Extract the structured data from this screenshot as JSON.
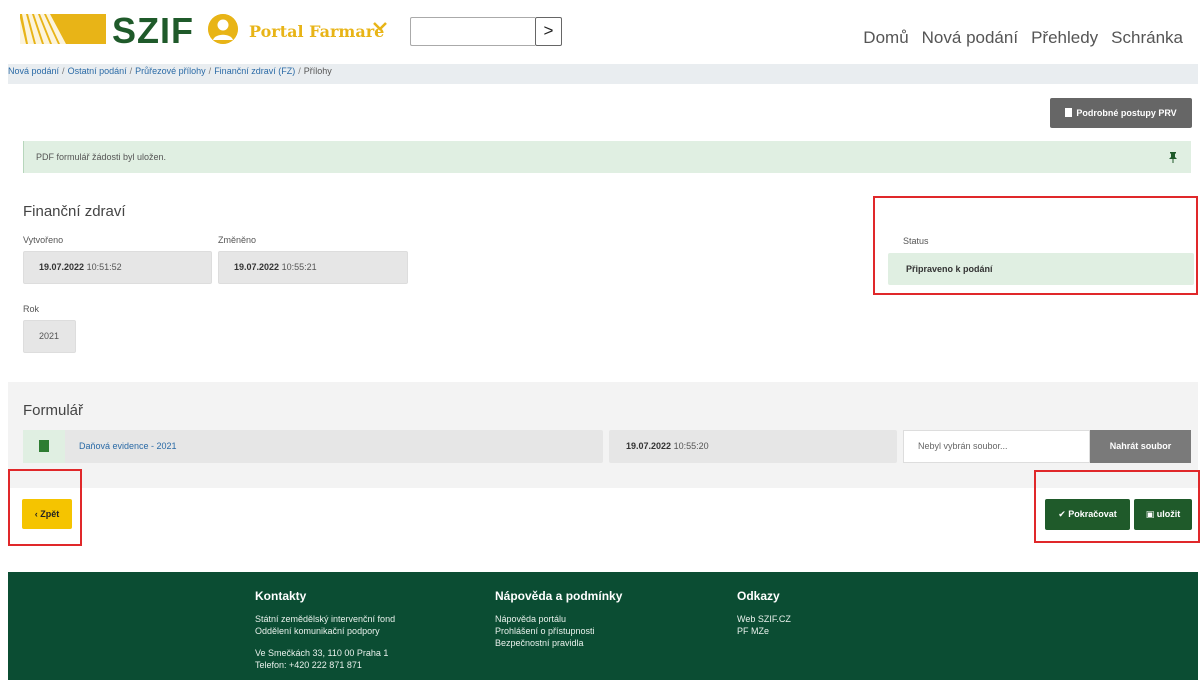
{
  "header": {
    "logo_text": "SZIF",
    "portal_label": "Portal Farmare",
    "search_button": ">",
    "nav": [
      "Domů",
      "Nová podání",
      "Přehledy",
      "Schránka"
    ]
  },
  "breadcrumb": {
    "items": [
      "Nová podání",
      "Ostatní podání",
      "Průřezové přílohy",
      "Finanční zdraví (FZ)",
      "Přílohy"
    ],
    "separator": "/"
  },
  "toolbar": {
    "prv_button": "Podrobné postupy PRV"
  },
  "alert": {
    "text": "PDF formulář žádosti byl uložen."
  },
  "detail": {
    "title": "Finanční zdraví",
    "created_label": "Vytvořeno",
    "created_date": "19.07.2022",
    "created_time": "10:51:52",
    "changed_label": "Změněno",
    "changed_date": "19.07.2022",
    "changed_time": "10:55:21",
    "status_label": "Status",
    "status_value": "Připraveno k podání",
    "year_label": "Rok",
    "year_value": "2021"
  },
  "form": {
    "title": "Formulář",
    "document_name": "Daňová evidence - 2021",
    "doc_date": "19.07.2022",
    "doc_time": "10:55:20",
    "file_placeholder": "Nebyl vybrán soubor...",
    "upload_button": "Nahrát soubor"
  },
  "actions": {
    "back": "Zpět",
    "continue": "Pokračovat",
    "save": "uložit"
  },
  "footer": {
    "contacts_title": "Kontakty",
    "contacts_lines": [
      "Státní zemědělský intervenční fond",
      "Oddělení komunikační podpory"
    ],
    "address_lines": [
      "Ve Smečkách 33, 110 00 Praha 1",
      "Telefon: +420 222 871 871"
    ],
    "help_title": "Nápověda a podmínky",
    "help_links": [
      "Nápověda portálu",
      "Prohlášení o přístupnosti",
      "Bezpečnostní pravidla"
    ],
    "links_title": "Odkazy",
    "links": [
      "Web SZIF.CZ",
      "PF MZe"
    ]
  },
  "colors": {
    "brand_green": "#1f5a2a",
    "brand_yellow": "#e8b417",
    "footer_green": "#0b4d33",
    "success_bg": "#e0efe2",
    "highlight_red": "#e0282a"
  }
}
